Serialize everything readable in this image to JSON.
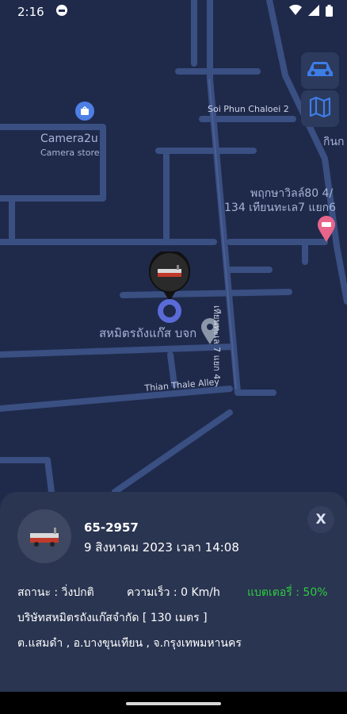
{
  "status_bar": {
    "time": "2:16"
  },
  "map": {
    "places": [
      {
        "name": "Camera2u",
        "subtitle": "Camera store"
      },
      {
        "name_line1": "พฤกษาวิลล์80 4/",
        "name_line2": "134 เทียนทะเล7 แยก6"
      },
      {
        "name": "สหมิตรถังแก๊ส บจก"
      }
    ],
    "streets": [
      "Soi Phun Chaloei 2",
      "Thian Thale Alley",
      "เทียนทะเล 7 แยก 4"
    ],
    "edge_label": "กินก"
  },
  "controls": {
    "car_button": "car-icon",
    "map_button": "map-icon"
  },
  "vehicle": {
    "plate": "65-2957",
    "datetime": "9 สิงหาคม 2023 เวลา 14:08",
    "status": "สถานะ : วิ่งปกติ",
    "speed": "ความเร็ว : 0 Km/h",
    "battery": "แบตเตอรี่ : 50%",
    "company": "บริษัทสหมิตรถังแก๊สจำกัด [ 130 เมตร ]",
    "address": "ต.แสมดำ , อ.บางขุนเทียน , จ.กรุงเทพมหานคร"
  },
  "panel": {
    "close_label": "X"
  },
  "colors": {
    "map_bg": "#1f2a4b",
    "road": "#3a4f82",
    "panel": "#2a3551",
    "battery": "#2ecc40",
    "location": "#5a6bd8"
  }
}
